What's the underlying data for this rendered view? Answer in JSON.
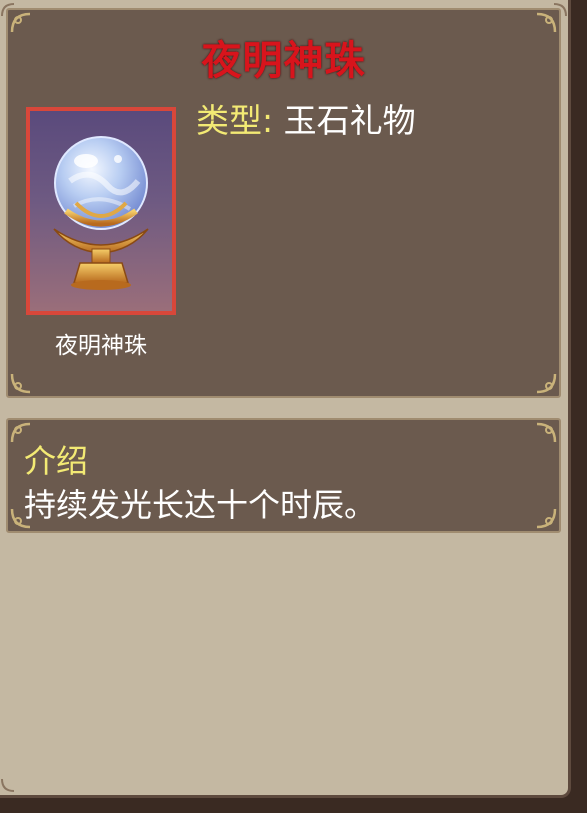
{
  "item": {
    "title": "夜明神珠",
    "caption": "夜明神珠",
    "icon": "crystal-orb-on-golden-stand",
    "type_label": "类型",
    "type_separator": ":",
    "type_value": "玉石礼物"
  },
  "description": {
    "heading": "介绍",
    "text": "持续发光长达十个时辰。"
  },
  "colors": {
    "title_red": "#d8141c",
    "label_yellow": "#f3ea74",
    "frame_red": "#d8473a",
    "box_brown": "#6b5a4e",
    "parchment": "#c4b8a2"
  }
}
